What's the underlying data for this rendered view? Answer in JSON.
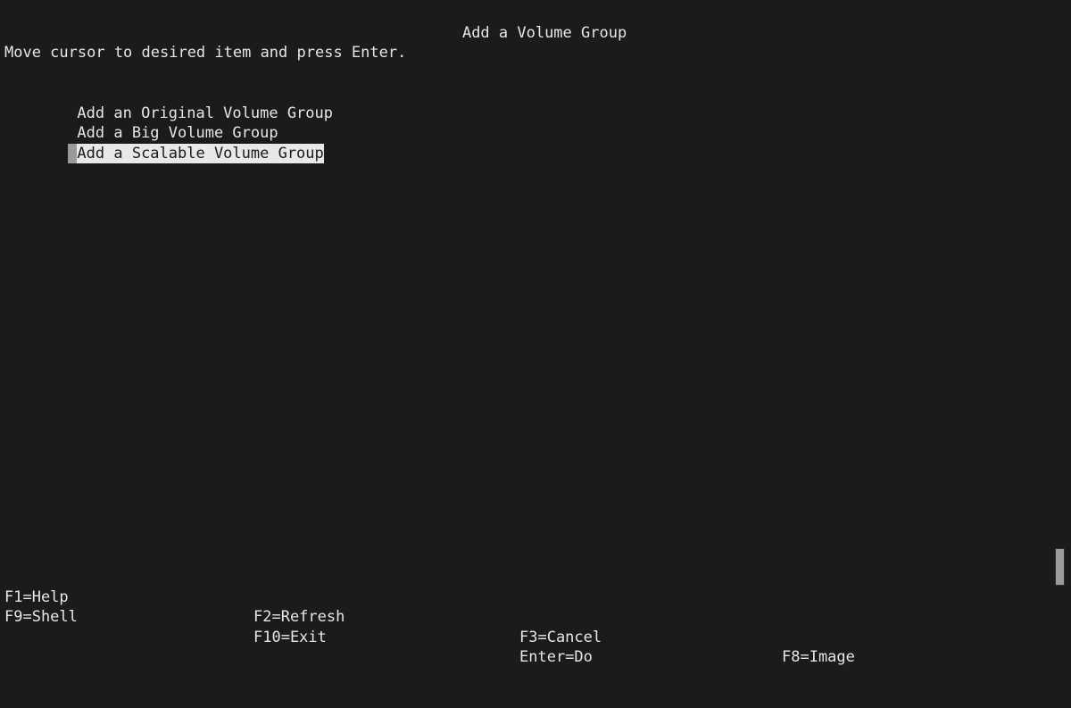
{
  "screen": {
    "background_color": "#1b1b1b",
    "foreground_color": "#e6e6e6",
    "highlight_background": "#e8e8e8",
    "highlight_foreground": "#1b1b1b",
    "cursor_color": "#9a9a9a"
  },
  "title": "Add a Volume Group",
  "instruction": "Move cursor to desired item and press Enter.",
  "menu": {
    "items": [
      {
        "label": "Add an Original Volume Group",
        "selected": false
      },
      {
        "label": "Add a Big Volume Group",
        "selected": false
      },
      {
        "label": "Add a Scalable Volume Group",
        "selected": true
      }
    ]
  },
  "function_keys": {
    "row1": [
      "F1=Help",
      "F2=Refresh",
      "F3=Cancel",
      "F8=Image"
    ],
    "row2": [
      "F9=Shell",
      "F10=Exit",
      "Enter=Do",
      ""
    ]
  },
  "scrollbar": {
    "thumb_color": "#9c9c9c"
  }
}
